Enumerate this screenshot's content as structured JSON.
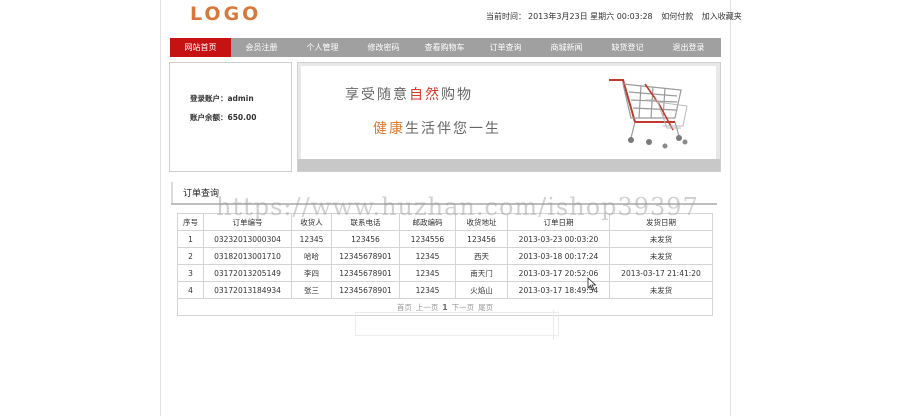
{
  "header": {
    "logo_text": "LOGO",
    "time_label": "当前时间：",
    "time_value": "2013年3月23日 星期六 00:03:28",
    "pay_link": "如何付款",
    "fav_link": "加入收藏夹"
  },
  "nav": {
    "items": [
      {
        "label": "网站首页",
        "active": true
      },
      {
        "label": "会员注册"
      },
      {
        "label": "个人管理"
      },
      {
        "label": "修改密码"
      },
      {
        "label": "查看购物车"
      },
      {
        "label": "订单查询"
      },
      {
        "label": "商城新闻"
      },
      {
        "label": "缺货登记"
      },
      {
        "label": "退出登录"
      }
    ]
  },
  "account": {
    "user_label": "登录账户：",
    "user_value": "admin",
    "balance_label": "账户余额：",
    "balance_value": "650.00"
  },
  "banner": {
    "line1_a": "享受随意",
    "line1_b": "自然",
    "line1_c": "购物",
    "line2_a": "健康",
    "line2_b": "生活伴您一生"
  },
  "orders": {
    "title": "订单查询",
    "headers": [
      "序号",
      "订单编号",
      "收货人",
      "联系电话",
      "邮政编码",
      "收货地址",
      "订单日期",
      "发货日期"
    ],
    "rows": [
      [
        "1",
        "03232013000304",
        "12345",
        "123456",
        "1234556",
        "123456",
        "2013-03-23 00:03:20",
        "未发货"
      ],
      [
        "2",
        "03182013001710",
        "哈哈",
        "12345678901",
        "12345",
        "西天",
        "2013-03-18 00:17:24",
        "未发货"
      ],
      [
        "3",
        "03172013205149",
        "李四",
        "12345678901",
        "12345",
        "南天门",
        "2013-03-17 20:52:06",
        "2013-03-17 21:41:20"
      ],
      [
        "4",
        "03172013184934",
        "张三",
        "12345678901",
        "12345",
        "火焰山",
        "2013-03-17 18:49:54",
        "未发货"
      ]
    ],
    "pager": {
      "first": "首页",
      "prev": "上一页",
      "current": "1",
      "next": "下一页",
      "last": "尾页"
    }
  },
  "watermark": "https://www.huzhan.com/ishop39397",
  "colors": {
    "nav_active": "#c61212",
    "nav_bg": "#a0a0a0",
    "logo": "#d9783c"
  }
}
